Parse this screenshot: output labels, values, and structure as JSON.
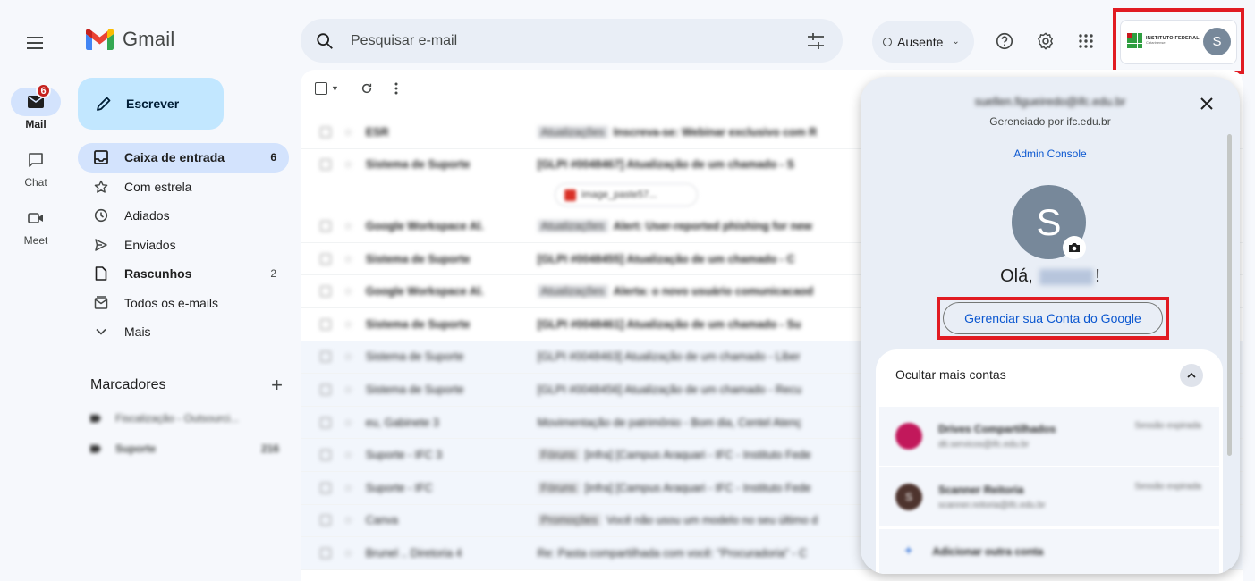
{
  "header": {
    "app_name": "Gmail",
    "search_placeholder": "Pesquisar e-mail",
    "status_label": "Ausente",
    "institution_name": "INSTITUTO FEDERAL",
    "institution_sub": "Catarinense",
    "avatar_letter": "S"
  },
  "rail": {
    "items": [
      {
        "label": "Mail",
        "badge": "6"
      },
      {
        "label": "Chat"
      },
      {
        "label": "Meet"
      }
    ]
  },
  "nav": {
    "compose_label": "Escrever",
    "items": [
      {
        "label": "Caixa de entrada",
        "count": "6"
      },
      {
        "label": "Com estrela"
      },
      {
        "label": "Adiados"
      },
      {
        "label": "Enviados"
      },
      {
        "label": "Rascunhos",
        "count": "2"
      },
      {
        "label": "Todos os e-mails"
      },
      {
        "label": "Mais"
      }
    ],
    "labels_heading": "Marcadores",
    "labels": [
      {
        "label": "Fiscalização - Outsourci..."
      },
      {
        "label": "Suporte",
        "count": "216"
      }
    ]
  },
  "mail_list": {
    "rows": [
      {
        "sender": "ESR",
        "tag": "Atualizações",
        "subject": "Inscreva-se: Webinar exclusivo com R"
      },
      {
        "sender": "Sistema de Suporte",
        "tag": "",
        "subject": "[GLPI #0048467] Atualização de um chamado - S"
      },
      {
        "sender": "Google Workspace Al.",
        "tag": "Atualizações",
        "subject": "Alert: User-reported phishing for new"
      },
      {
        "sender": "Sistema de Suporte",
        "tag": "",
        "subject": "[GLPI #0048455] Atualização de um chamado - C"
      },
      {
        "sender": "Google Workspace Al.",
        "tag": "Atualizações",
        "subject": "Alerta: o novo usuário comunicacaod"
      },
      {
        "sender": "Sistema de Suporte",
        "tag": "",
        "subject": "[GLPI #0048461] Atualização de um chamado - Su"
      },
      {
        "sender": "Sistema de Suporte",
        "tag": "",
        "subject": "[GLPI #0048463] Atualização de um chamado - Liber"
      },
      {
        "sender": "Sistema de Suporte",
        "tag": "",
        "subject": "[GLPI #0048456] Atualização de um chamado - Recu"
      },
      {
        "sender": "eu, Gabinete 3",
        "tag": "",
        "subject": "Movimentação de patrimônio - Bom dia, Centel Atenç"
      },
      {
        "sender": "Suporte - IFC 3",
        "tag": "Fóruns",
        "subject": "[infra] [Campus Araquari - IFC - Instituto Fede"
      },
      {
        "sender": "Suporte - IFC",
        "tag": "Fóruns",
        "subject": "[infra] [Campus Araquari - IFC - Instituto Fede"
      },
      {
        "sender": "Canva",
        "tag": "Promoções",
        "subject": "Você não usou um modelo no seu último d"
      },
      {
        "sender": "Brunel .. Diretoria 4",
        "tag": "",
        "subject": "Re: Pasta compartilhada com você: \"Procuradoria\" - C"
      }
    ],
    "attachment_name": "image_paste57..."
  },
  "account_menu": {
    "email": "suellen.figueiredo@ifc.edu.br",
    "managed_by": "Gerenciado por ifc.edu.br",
    "admin_console": "Admin Console",
    "avatar_letter": "S",
    "greeting_prefix": "Olá,",
    "greeting_name": "Suellen",
    "greeting_suffix": "!",
    "manage_button": "Gerenciar sua Conta do Google",
    "hide_accounts": "Ocultar mais contas",
    "accounts": [
      {
        "name": "Drives Compartilhados",
        "email": "dti.servicos@ifc.edu.br",
        "status": "Sessão expirada",
        "color": "#c2185b"
      },
      {
        "name": "Scanner Reitoria",
        "email": "scanner.reitoria@ifc.edu.br",
        "status": "Sessão expirada",
        "color": "#4e342e"
      }
    ],
    "add_account": "Adicionar outra conta"
  },
  "colors": {
    "accent_blue": "#0b57d0",
    "highlight_red": "#e11b22",
    "compose_bg": "#c2e7ff",
    "active_nav_bg": "#d3e3fd"
  }
}
